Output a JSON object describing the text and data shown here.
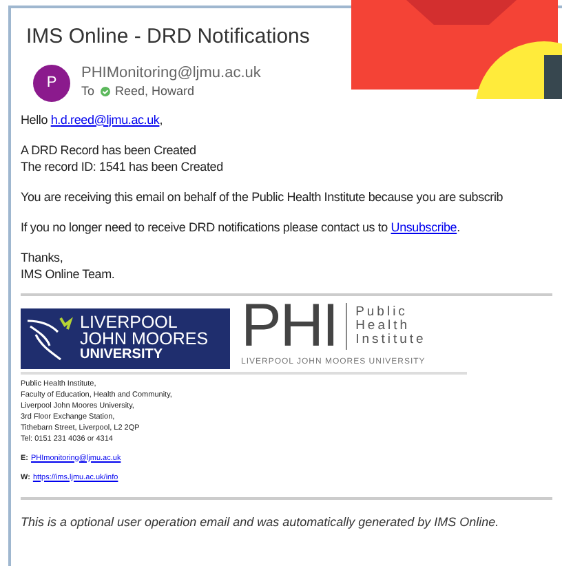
{
  "email": {
    "subject": "IMS Online - DRD Notifications",
    "avatar_letter": "P",
    "sender": "PHIMonitoring@ljmu.ac.uk",
    "to_label": "To",
    "recipient": "Reed, Howard"
  },
  "body": {
    "greeting": "Hello",
    "greeting_link": "h.d.reed@ljmu.ac.uk",
    "greeting_end": ",",
    "lines": [
      "A DRD Record has been Created",
      "The record ID: 1541 has been Created"
    ],
    "notice": "You are receiving this email on behalf of the Public Health Institute because you are subscrib",
    "unsubscribe_text": "If you no longer need to receive DRD notifications please contact us to",
    "unsubscribe_link": "Unsubscribe",
    "unsubscribe_end": ".",
    "signoff": [
      "Thanks,",
      "IMS Online Team."
    ]
  },
  "logos": {
    "university": [
      "LIVERPOOL",
      "JOHN MOORES",
      "UNIVERSITY"
    ],
    "phi": "PHI",
    "phi_name": [
      "Public",
      "Health",
      "Institute"
    ],
    "phi_sub": "LIVERPOOL JOHN MOORES UNIVERSITY"
  },
  "address": [
    "Public Health Institute,",
    "Faculty of Education, Health and Community,",
    "Liverpool John Moores University,",
    "3rd Floor Exchange Station,",
    "Tithebarn Street, Liverpool, L2 2QP",
    "Tel: 0151 231 4036 or 4314"
  ],
  "contacts": [
    {
      "label": "E:",
      "link": "PHImonitoring@ljmu.ac.uk"
    },
    {
      "label": "W:",
      "link": "https://ims.ljmu.ac.uk/info"
    }
  ],
  "footer": "This is a optional user operation email and was automatically generated by IMS Online."
}
